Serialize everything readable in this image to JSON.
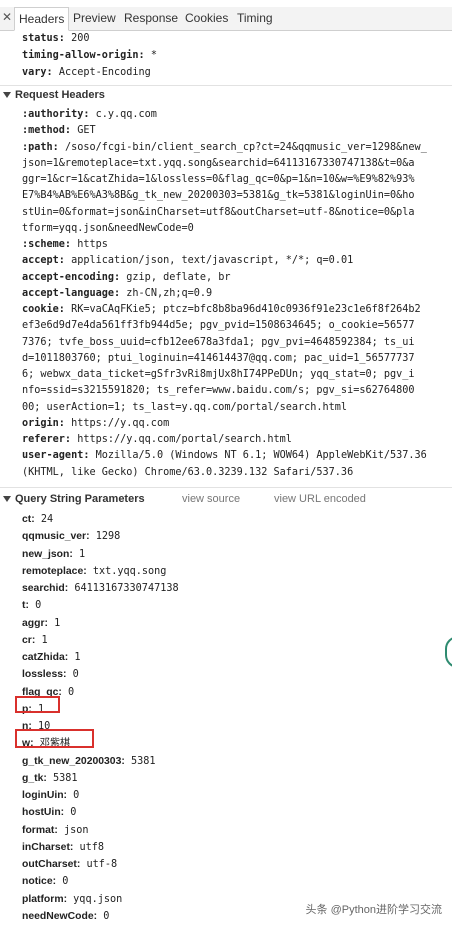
{
  "tabs": [
    "Headers",
    "Preview",
    "Response",
    "Cookies",
    "Timing"
  ],
  "response_headers_tail": [
    {
      "key": "status:",
      "value": "200"
    },
    {
      "key": "timing-allow-origin:",
      "value": "*"
    },
    {
      "key": "vary:",
      "value": "Accept-Encoding"
    }
  ],
  "request_headers": {
    "title": "Request Headers",
    "lines": [
      {
        "key": ":authority:",
        "value": "c.y.qq.com"
      },
      {
        "key": ":method:",
        "value": "GET"
      },
      {
        "key": ":path:",
        "value": "/soso/fcgi-bin/client_search_cp?ct=24&qqmusic_ver=1298&new_"
      },
      {
        "key": "",
        "value": "json=1&remoteplace=txt.yqq.song&searchid=64113167330747138&t=0&a"
      },
      {
        "key": "",
        "value": "ggr=1&cr=1&catZhida=1&lossless=0&flag_qc=0&p=1&n=10&w=%E9%82%93%"
      },
      {
        "key": "",
        "value": "E7%B4%AB%E6%A3%8B&g_tk_new_20200303=5381&g_tk=5381&loginUin=0&ho"
      },
      {
        "key": "",
        "value": "stUin=0&format=json&inCharset=utf8&outCharset=utf-8&notice=0&pla"
      },
      {
        "key": "",
        "value": "tform=yqq.json&needNewCode=0"
      },
      {
        "key": ":scheme:",
        "value": "https"
      },
      {
        "key": "accept:",
        "value": "application/json, text/javascript, */*; q=0.01"
      },
      {
        "key": "accept-encoding:",
        "value": "gzip, deflate, br"
      },
      {
        "key": "accept-language:",
        "value": "zh-CN,zh;q=0.9"
      },
      {
        "key": "cookie:",
        "value": "RK=vaCAqFKie5; ptcz=bfc8b8ba96d410c0936f91e23c1e6f8f264b2"
      },
      {
        "key": "",
        "value": "ef3e6d9d7e4da561ff3fb944d5e; pgv_pvid=1508634645; o_cookie=56577"
      },
      {
        "key": "",
        "value": "7376; tvfe_boss_uuid=cfb12ee678a3fda1; pgv_pvi=4648592384; ts_ui"
      },
      {
        "key": "",
        "value": "d=1011803760; ptui_loginuin=414614437@qq.com; pac_uid=1_56577737"
      },
      {
        "key": "",
        "value": "6; webwx_data_ticket=gSfr3vRi8mjUx8hI74PPeDUn; yqq_stat=0; pgv_i"
      },
      {
        "key": "",
        "value": "nfo=ssid=s3215591820; ts_refer=www.baidu.com/s; pgv_si=s62764800"
      },
      {
        "key": "",
        "value": "00; userAction=1; ts_last=y.qq.com/portal/search.html"
      },
      {
        "key": "origin:",
        "value": "https://y.qq.com"
      },
      {
        "key": "referer:",
        "value": "https://y.qq.com/portal/search.html"
      },
      {
        "key": "user-agent:",
        "value": "Mozilla/5.0 (Windows NT 6.1; WOW64) AppleWebKit/537.36"
      },
      {
        "key": "",
        "value": "(KHTML, like Gecko) Chrome/63.0.3239.132 Safari/537.36"
      }
    ]
  },
  "query_string": {
    "title": "Query String Parameters",
    "view_source": "view source",
    "view_url_encoded": "view URL encoded",
    "params": [
      {
        "key": "ct:",
        "value": "24"
      },
      {
        "key": "qqmusic_ver:",
        "value": "1298"
      },
      {
        "key": "new_json:",
        "value": "1"
      },
      {
        "key": "remoteplace:",
        "value": "txt.yqq.song"
      },
      {
        "key": "searchid:",
        "value": "64113167330747138"
      },
      {
        "key": "t:",
        "value": "0"
      },
      {
        "key": "aggr:",
        "value": "1"
      },
      {
        "key": "cr:",
        "value": "1"
      },
      {
        "key": "catZhida:",
        "value": "1"
      },
      {
        "key": "lossless:",
        "value": "0"
      },
      {
        "key": "flag_qc:",
        "value": "0"
      },
      {
        "key": "p:",
        "value": "1"
      },
      {
        "key": "n:",
        "value": "10"
      },
      {
        "key": "w:",
        "value": "邓紫棋"
      },
      {
        "key": "g_tk_new_20200303:",
        "value": "5381"
      },
      {
        "key": "g_tk:",
        "value": "5381"
      },
      {
        "key": "loginUin:",
        "value": "0"
      },
      {
        "key": "hostUin:",
        "value": "0"
      },
      {
        "key": "format:",
        "value": "json"
      },
      {
        "key": "inCharset:",
        "value": "utf8"
      },
      {
        "key": "outCharset:",
        "value": "utf-8"
      },
      {
        "key": "notice:",
        "value": "0"
      },
      {
        "key": "platform:",
        "value": "yqq.json"
      },
      {
        "key": "needNewCode:",
        "value": "0"
      }
    ]
  },
  "watermark": "头条 @Python进阶学习交流",
  "colors": {
    "highlight_box": "#d9302c",
    "tab_border": "#cfcfcf"
  }
}
